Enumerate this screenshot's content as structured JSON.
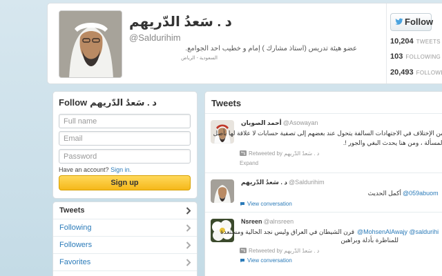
{
  "profile": {
    "name": "د . سَعدُ الدّريهم",
    "handle": "@Saldurihim",
    "bio": "عضو هيئة تدريس (أستاذ مشارك ) إمام و خطيب احد الجوامع.",
    "location": "السعودية - الرياض",
    "follow_label": "Follow",
    "stats": [
      {
        "value": "10,204",
        "label": "TWEETS"
      },
      {
        "value": "103",
        "label": "FOLLOWING"
      },
      {
        "value": "20,493",
        "label": "FOLLOWERS"
      }
    ]
  },
  "follow_box": {
    "title_prefix": "Follow",
    "title_name": "د . سَعدُ الدّريهم",
    "full_name_placeholder": "Full name",
    "email_placeholder": "Email",
    "password_placeholder": "Password",
    "have_account": "Have an account?",
    "sign_in": "Sign in.",
    "signup_label": "Sign up"
  },
  "nav": {
    "items": [
      {
        "label": "Tweets",
        "active": true
      },
      {
        "label": "Following",
        "active": false
      },
      {
        "label": "Followers",
        "active": false
      },
      {
        "label": "Favorites",
        "active": false
      }
    ]
  },
  "timeline": {
    "title": "Tweets",
    "tweets": [
      {
        "name": "أحمد الصويان",
        "handle": "@Asowayan",
        "lines": [
          "من الإختلاف في الاجتهادات السالفة يتحول عند بعضهم إلى تصفية حسابات لا علاقة لها بأصل",
          "المسألة ، ومن هنا يحدث البغي والجور !."
        ],
        "retweeted_by_label": "Retweeted by",
        "retweeted_by_name": "د . سَعدُ الدّريهم",
        "action": "Expand"
      },
      {
        "name": "د . سَعدُ الدّريهم",
        "handle": "@Saldurihim",
        "mention": "@059abuom",
        "text": "أكمل الحديث",
        "action": "View conversation"
      },
      {
        "name": "Nsreen",
        "handle": "@alnsreen",
        "mentions": "@MohsenAlAwajy @saldurihi",
        "line1": "قرن الشيطان في العراق وليس نجد الحالية ومستعدة",
        "line2": "للمناظرة بأدلة وبراهين",
        "retweeted_by_label": "Retweeted by",
        "retweeted_by_name": "د . سَعدُ الدّريهم",
        "action": "View conversation"
      }
    ]
  },
  "colors": {
    "link": "#2b7bb9",
    "signup": "#f5b81a",
    "background": "#c9dfea"
  }
}
